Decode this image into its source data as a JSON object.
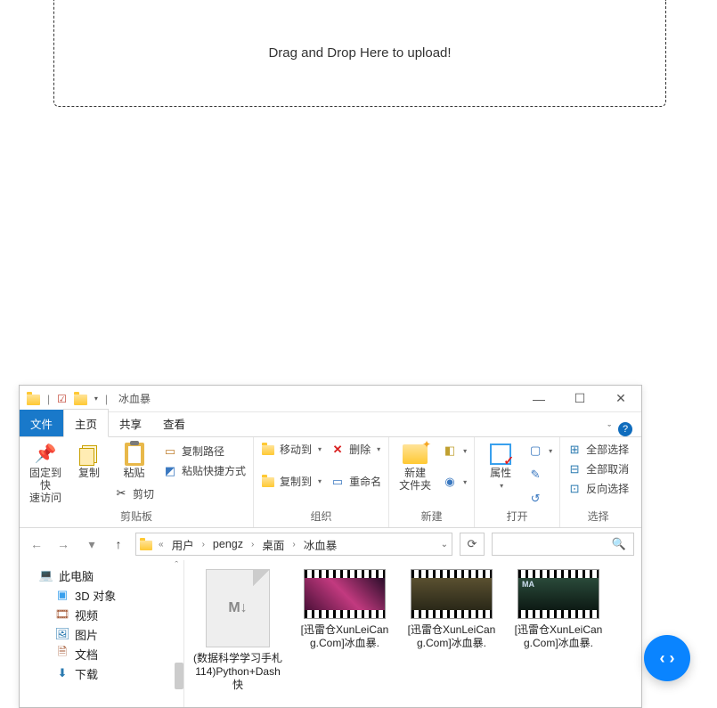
{
  "dropzone": {
    "text": "Drag and Drop Here to upload!"
  },
  "explorer": {
    "title": "冰血暴",
    "tabs": {
      "file": "文件",
      "home": "主页",
      "share": "共享",
      "view": "查看"
    },
    "ribbon": {
      "pin": {
        "label": "固定到快\n速访问"
      },
      "copy": {
        "label": "复制"
      },
      "paste": {
        "label": "粘贴"
      },
      "cut": {
        "label": "剪切"
      },
      "copyPath": {
        "label": "复制路径"
      },
      "pasteShortcut": {
        "label": "粘贴快捷方式"
      },
      "clipboardGroup": "剪贴板",
      "moveTo": {
        "label": "移动到"
      },
      "copyTo": {
        "label": "复制到"
      },
      "delete": {
        "label": "删除"
      },
      "rename": {
        "label": "重命名"
      },
      "organizeGroup": "组织",
      "newFolder": {
        "label": "新建\n文件夹"
      },
      "newGroup": "新建",
      "properties": {
        "label": "属性"
      },
      "openGroup": "打开",
      "selectAll": {
        "label": "全部选择"
      },
      "selectNone": {
        "label": "全部取消"
      },
      "invertSel": {
        "label": "反向选择"
      },
      "selectGroup": "选择"
    },
    "breadcrumb": {
      "pre": "«",
      "items": [
        "用户",
        "pengz",
        "桌面",
        "冰血暴"
      ]
    },
    "tree": {
      "thisPC": "此电脑",
      "obj3d": "3D 对象",
      "videos": "视频",
      "pictures": "图片",
      "documents": "文档",
      "downloads": "下载"
    },
    "files": [
      {
        "name": "(数据科学学习手札114)Python+Dash快",
        "kind": "md"
      },
      {
        "name": "[迅雷仓XunLeiCang.Com]冰血暴.",
        "kind": "v1"
      },
      {
        "name": "[迅雷仓XunLeiCang.Com]冰血暴.",
        "kind": "v2"
      },
      {
        "name": "[迅雷仓XunLeiCang.Com]冰血暴.",
        "kind": "v3"
      }
    ]
  },
  "floatnav": {
    "glyph": "‹ ›"
  }
}
